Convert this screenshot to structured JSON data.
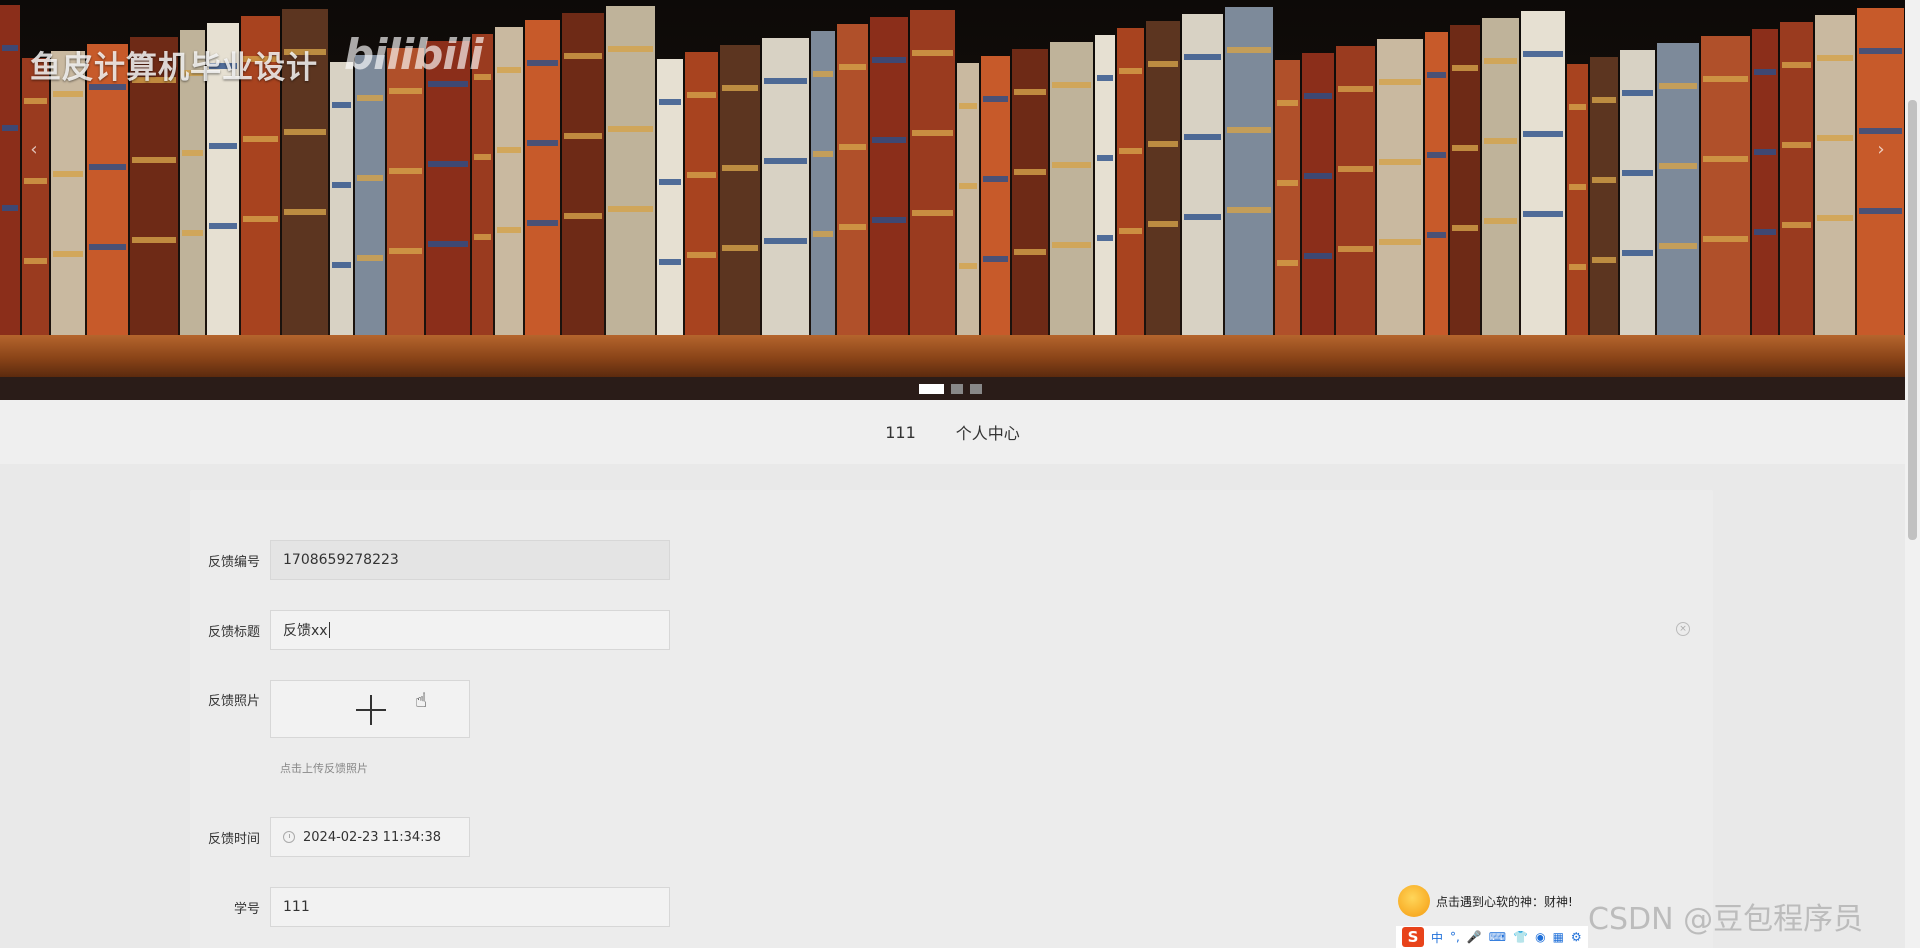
{
  "banner": {
    "watermark_title": "鱼皮计算机毕业设计",
    "logo_text": "bilibili",
    "prev_arrow": "‹",
    "next_arrow": "›",
    "slide_count": 3,
    "active_slide": 1
  },
  "nav": {
    "items": [
      {
        "label": "111"
      },
      {
        "label": "个人中心"
      }
    ]
  },
  "form": {
    "feedback_id": {
      "label": "反馈编号",
      "value": "1708659278223"
    },
    "feedback_title": {
      "label": "反馈标题",
      "value": "反馈xx"
    },
    "feedback_photo": {
      "label": "反馈照片",
      "hint": "点击上传反馈照片"
    },
    "feedback_time": {
      "label": "反馈时间",
      "value": "2024-02-23 11:34:38"
    },
    "student_id": {
      "label": "学号",
      "value": "111"
    }
  },
  "ime": {
    "tip": "点击遇到心软的神：财神!",
    "logo": "S",
    "icons": [
      "中",
      "°,",
      "🎤",
      "⌨",
      "👕",
      "◉",
      "▦",
      "⚙"
    ]
  },
  "overlay": {
    "csdn_watermark": "CSDN @豆包程序员"
  },
  "colors": {
    "page_bg": "#e9e9e9",
    "shelf_wood": "#8a4418",
    "ime_logo": "#e8431a"
  }
}
